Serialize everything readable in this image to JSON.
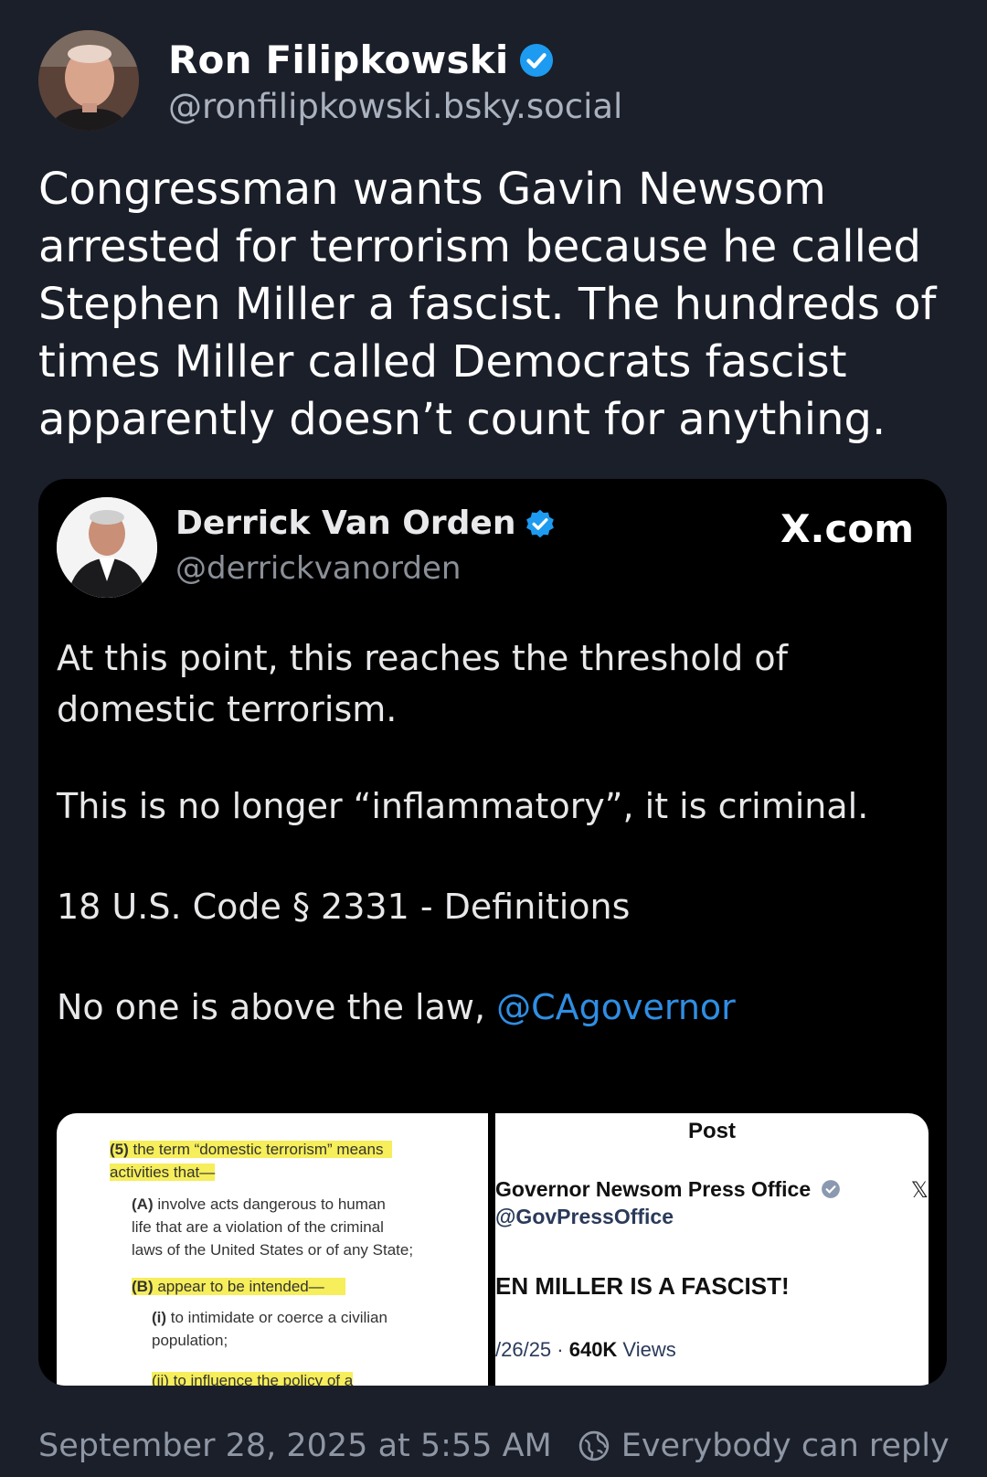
{
  "post": {
    "author_name": "Ron Filipkowski",
    "author_handle": "@ronfilipkowski.bsky.social",
    "text": "Congressman wants Gavin Newsom arrested for terrorism because he called Stephen Miller a fascist. The hundreds of times Miller called Democrats fascist apparently doesn’t count for anything.",
    "timestamp": "September 28, 2025 at 5:55 AM",
    "reply_setting": "Everybody can reply"
  },
  "embed": {
    "author_name": "Derrick Van Orden",
    "author_handle": "@derrickvanorden",
    "source": "X.com",
    "paragraphs": {
      "p1": "At this point, this reaches the threshold of domestic terrorism.",
      "p2": "This is no longer “inflammatory”, it is criminal.",
      "p3": "18 U.S. Code § 2331 - Definitions",
      "p4_prefix": "No one is above the law, ",
      "p4_mention": "@CAgovernor"
    },
    "doc_image": {
      "l1_num": "(5)",
      "l1_text": " the term “domestic terrorism” means",
      "l2": "activities that—",
      "l3_num": "(A)",
      "l3_text": " involve acts dangerous to human",
      "l4": "life that are a violation of the criminal",
      "l5": "laws of the United States or of any State;",
      "l6_num": "(B)",
      "l6_text": " appear to be intended—",
      "l7_num": "(i)",
      "l7_text": " to intimidate or coerce a civilian",
      "l8": "population;",
      "l9": "(ii) to influence the policy of a"
    },
    "shot_image": {
      "title": "Post",
      "name": "Governor Newsom Press Office",
      "handle": "@GovPressOffice",
      "x_glyph": "𝕏",
      "body": "EN MILLER IS A FASCIST!",
      "date": "/26/25 · ",
      "views_num": "640K",
      "views_label": " Views"
    }
  },
  "colors": {
    "background": "#1b1f29",
    "verified_blue": "#1d9bf0",
    "mention_blue": "#2f8ee3",
    "highlight": "#f6ee5a"
  }
}
